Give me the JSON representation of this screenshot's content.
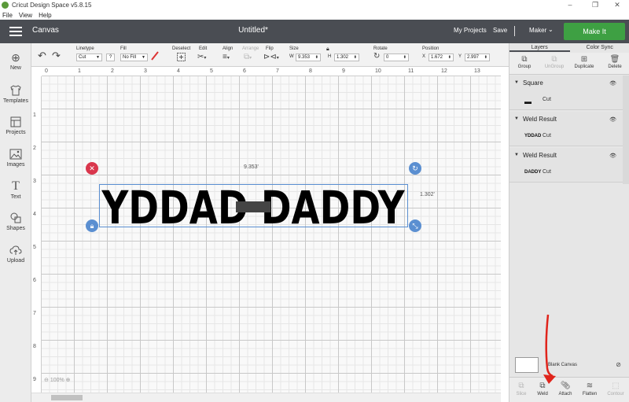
{
  "window": {
    "title": "Cricut Design Space  v5.8.15",
    "controls": [
      "–",
      "❐",
      "✕"
    ]
  },
  "menu": [
    "File",
    "View",
    "Help"
  ],
  "header": {
    "section": "Canvas",
    "doc_title": "Untitled*",
    "my_projects": "My Projects",
    "save": "Save",
    "separator": "|",
    "machine": "Maker",
    "make_it": "Make It",
    "accent": "#3ea043"
  },
  "left_tools": [
    {
      "label": "New",
      "icon": "plus-circle-icon"
    },
    {
      "label": "Templates",
      "icon": "shirt-icon"
    },
    {
      "label": "Projects",
      "icon": "projects-icon"
    },
    {
      "label": "Images",
      "icon": "image-icon"
    },
    {
      "label": "Text",
      "icon": "text-icon"
    },
    {
      "label": "Shapes",
      "icon": "shapes-icon"
    },
    {
      "label": "Upload",
      "icon": "upload-icon"
    }
  ],
  "toolbar": {
    "linetype_label": "Linetype",
    "linetype_value": "Cut",
    "fill_label": "Fill",
    "fill_value": "No Fill",
    "deselect_label": "Deselect",
    "edit_label": "Edit",
    "align_label": "Align",
    "arrange_label": "Arrange",
    "flip_label": "Flip",
    "size_label": "Size",
    "w_label": "W",
    "w_value": "9.353",
    "h_label": "H",
    "h_value": "1.302",
    "rotate_label": "Rotate",
    "rotate_value": "0",
    "position_label": "Position",
    "x_label": "X",
    "x_value": "1.672",
    "y_label": "Y",
    "y_value": "2.997",
    "help": "?"
  },
  "rulers": {
    "h": [
      "0",
      "1",
      "2",
      "3",
      "4",
      "5",
      "6",
      "7",
      "8",
      "9",
      "10",
      "11",
      "12",
      "13"
    ],
    "v": [
      "1",
      "2",
      "3",
      "4",
      "5",
      "6",
      "7",
      "8",
      "9"
    ]
  },
  "canvas": {
    "width_dim": "9.353'",
    "height_dim": "1.302'",
    "zoom": "100%",
    "design_text": "YDDAD DADDY",
    "handle_colors": {
      "delete": "#d9364c",
      "other": "#5b8fd1"
    }
  },
  "right_panel": {
    "tabs": [
      "Layers",
      "Color Sync"
    ],
    "layer_buttons": [
      "Group",
      "UnGroup",
      "Duplicate",
      "Delete"
    ],
    "layers": [
      {
        "name": "Square",
        "thumb": "▬",
        "op": "Cut"
      },
      {
        "name": "Weld Result",
        "thumb": "YDDAD",
        "op": "Cut"
      },
      {
        "name": "Weld Result",
        "thumb": "DADDY",
        "op": "Cut"
      }
    ],
    "blank_canvas": "Blank Canvas",
    "actions": [
      "Slice",
      "Weld",
      "Attach",
      "Flatten",
      "Contour"
    ]
  },
  "annotation_color": "#e0241b"
}
